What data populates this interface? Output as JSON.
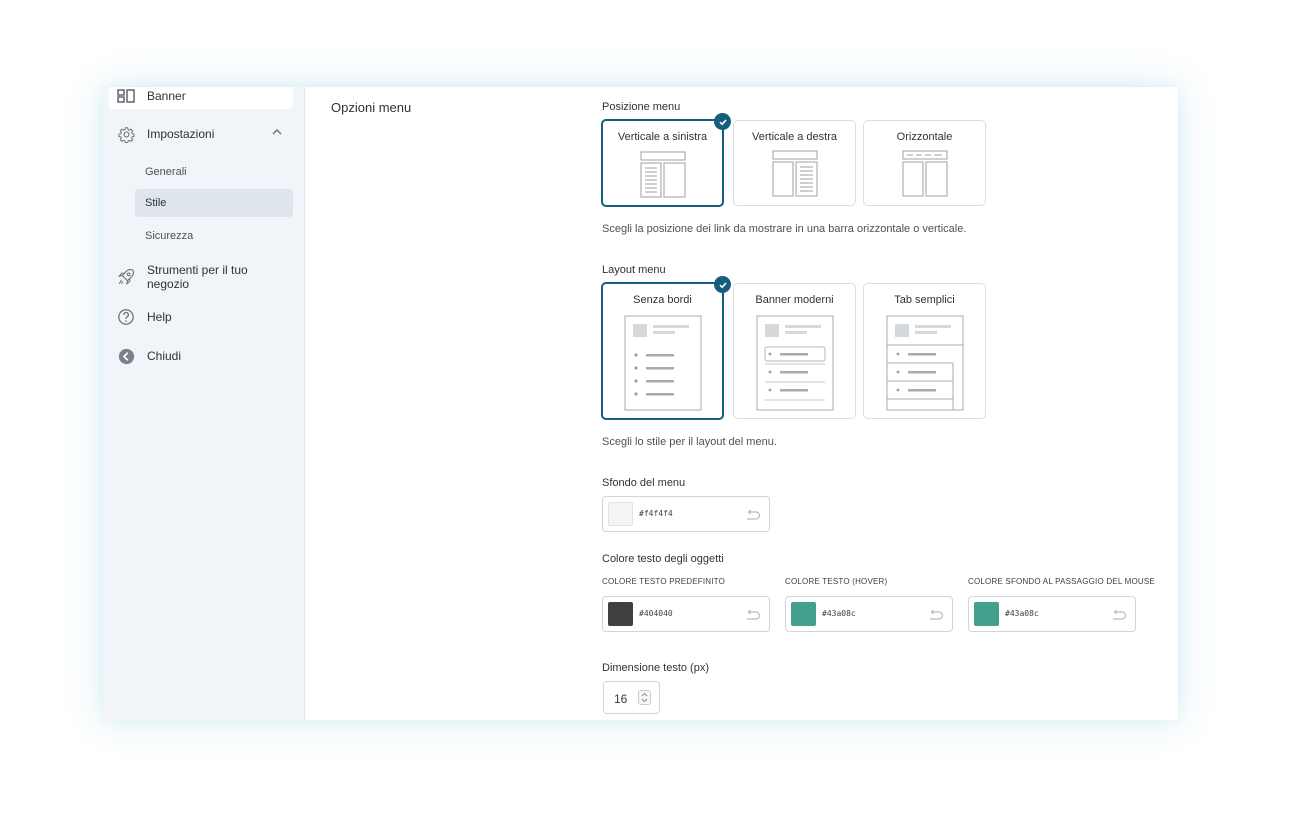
{
  "sidebar": {
    "banner_label": "Banner",
    "settings_label": "Impostazioni",
    "sub_items": [
      "Generali",
      "Stile",
      "Sicurezza"
    ],
    "active_sub_item": "Stile",
    "tools_label": "Strumenti per il tuo negozio",
    "help_label": "Help",
    "close_label": "Chiudi"
  },
  "main": {
    "section_title": "Opzioni menu",
    "menu_position": {
      "label": "Posizione menu",
      "options": [
        "Verticale a sinistra",
        "Verticale a destra",
        "Orizzontale"
      ],
      "selected": "Verticale a sinistra",
      "hint": "Scegli la posizione dei link da mostrare in una barra orizzontale o verticale."
    },
    "menu_layout": {
      "label": "Layout menu",
      "options": [
        "Senza bordi",
        "Banner moderni",
        "Tab semplici"
      ],
      "selected": "Senza bordi",
      "hint": "Scegli lo stile per il layout del menu."
    },
    "menu_background": {
      "label": "Sfondo del menu",
      "value": "#f4f4f4",
      "color": "#f4f4f4"
    },
    "item_text_color": {
      "label": "Colore testo degli oggetti",
      "fields": [
        {
          "label": "COLORE TESTO PREDEFINITO",
          "value": "#404040",
          "color": "#404040"
        },
        {
          "label": "COLORE TESTO (HOVER)",
          "value": "#43a08c",
          "color": "#43a08c"
        },
        {
          "label": "COLORE SFONDO AL PASSAGGIO DEL MOUSE",
          "value": "#43a08c",
          "color": "#43a08c"
        }
      ]
    },
    "text_size": {
      "label": "Dimensione testo (px)",
      "value": "16"
    }
  },
  "colors": {
    "accent": "#14607c",
    "sidebar_bg": "#f1f4f8",
    "active_item_bg": "#dfe5ed"
  }
}
